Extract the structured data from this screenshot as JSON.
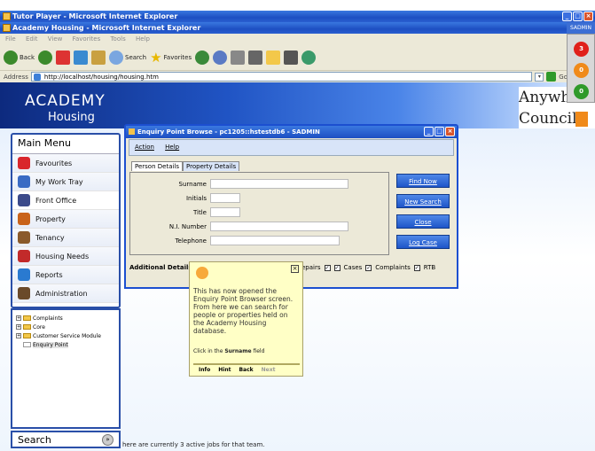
{
  "outer_window": {
    "title": "Tutor Player - Microsoft Internet Explorer"
  },
  "browser": {
    "title": "Academy Housing - Microsoft Internet Explorer",
    "menu": [
      "File",
      "Edit",
      "View",
      "Favorites",
      "Tools",
      "Help"
    ],
    "toolbar": {
      "back": "Back",
      "search": "Search",
      "favorites": "Favorites"
    },
    "address_label": "Address",
    "url": "http://localhost/housing/housing.htm",
    "go": "Go"
  },
  "app": {
    "logo_line1": "ACADEMY",
    "logo_line2": "Housing",
    "council_line1": "Anywhere",
    "council_line2": "Council",
    "user": "SADMIN",
    "traffic_lights": [
      {
        "value": "3",
        "color": "#e0201b"
      },
      {
        "value": "0",
        "color": "#f08a1a"
      },
      {
        "value": "0",
        "color": "#2f9a2a"
      }
    ]
  },
  "main_menu": {
    "title": "Main Menu",
    "items": [
      {
        "label": "Favourites",
        "icon": "heart-icon",
        "color": "#d9262c"
      },
      {
        "label": "My Work Tray",
        "icon": "tray-icon",
        "color": "#3a6bc4"
      },
      {
        "label": "Front Office",
        "icon": "front-office-icon",
        "color": "#3b4a8a"
      },
      {
        "label": "Property",
        "icon": "house-icon",
        "color": "#c9631a"
      },
      {
        "label": "Tenancy",
        "icon": "tenancy-icon",
        "color": "#8a5a2a"
      },
      {
        "label": "Housing Needs",
        "icon": "housing-needs-icon",
        "color": "#c22a2a"
      },
      {
        "label": "Reports",
        "icon": "reports-icon",
        "color": "#2a7ad0"
      },
      {
        "label": "Administration",
        "icon": "admin-icon",
        "color": "#6a4a2a"
      }
    ]
  },
  "tree": {
    "items": [
      "Complaints",
      "Core",
      "Customer Service Module",
      "Enquiry Point"
    ]
  },
  "search_panel": {
    "label": "Search"
  },
  "status_text": "here are currently 3 active jobs for that team.",
  "dialog": {
    "title": "Enquiry Point Browse - pc1205::hstestdb6 - SADMIN",
    "menu": [
      "Action",
      "Help"
    ],
    "tabs": [
      "Person Details",
      "Property Details"
    ],
    "fields": [
      {
        "label": "Surname",
        "value": ""
      },
      {
        "label": "Initials",
        "value": ""
      },
      {
        "label": "Title",
        "value": ""
      },
      {
        "label": "N.I. Number",
        "value": ""
      },
      {
        "label": "Telephone",
        "value": ""
      }
    ],
    "buttons": [
      "Find Now",
      "New Search",
      "Close",
      "Log Case"
    ],
    "additional_label": "Additional Details",
    "checkboxes": [
      {
        "label": "epairs",
        "checked": true
      },
      {
        "label": "Cases",
        "checked": true
      },
      {
        "label": "Complaints",
        "checked": true
      },
      {
        "label": "RTB",
        "checked": true
      }
    ]
  },
  "hint": {
    "text": "This has now opened the Enquiry Point Browser screen. From here we can search for people or properties held on the Academy Housing database.",
    "instruction_prefix": "Click in the ",
    "instruction_bold": "Surname",
    "instruction_suffix": " field",
    "nav": [
      "Info",
      "Hint",
      "Back",
      "Next"
    ]
  }
}
